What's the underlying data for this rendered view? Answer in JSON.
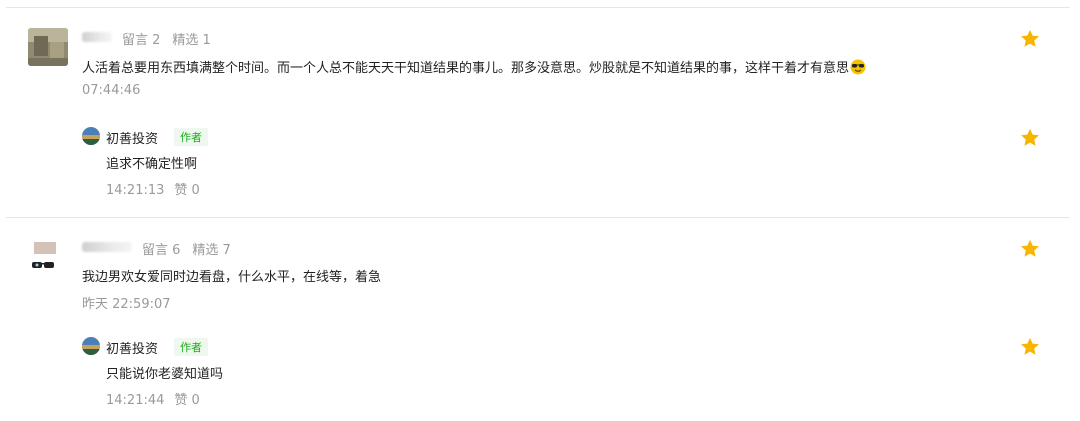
{
  "comments": [
    {
      "count_label": "留言 2",
      "featured_label": "精选 1",
      "text": "人活着总要用东西填满整个时间。而一个人总不能天天干知道结果的事儿。那多没意思。炒股就是不知道结果的事，这样干着才有意思",
      "emoji": "sunglasses-emoji",
      "time": "07:44:46",
      "reply": {
        "author": "初善投资",
        "badge": "作者",
        "text": "追求不确定性啊",
        "time": "14:21:13",
        "likes": "赞 0"
      }
    },
    {
      "count_label": "留言 6",
      "featured_label": "精选 7",
      "text": "我边男欢女爱同时边看盘，什么水平，在线等，着急",
      "time": "昨天 22:59:07",
      "reply": {
        "author": "初善投资",
        "badge": "作者",
        "text": "只能说你老婆知道吗",
        "time": "14:21:44",
        "likes": "赞 0"
      }
    }
  ],
  "colors": {
    "star": "#f7b500",
    "author_badge": "#1aad19",
    "meta": "#9a9a9a"
  }
}
